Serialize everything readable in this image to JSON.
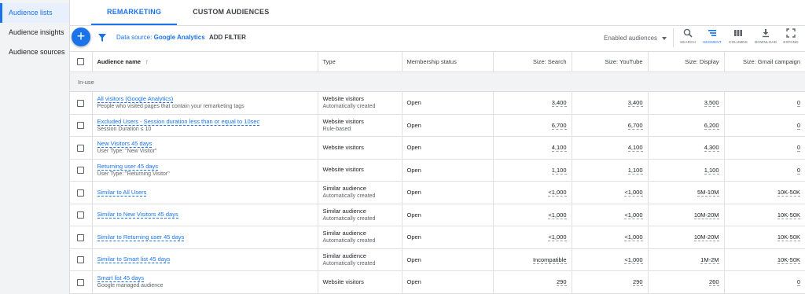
{
  "nav": {
    "items": [
      {
        "label": "Audience lists"
      },
      {
        "label": "Audience insights"
      },
      {
        "label": "Audience sources"
      }
    ]
  },
  "tabs": [
    {
      "label": "REMARKETING"
    },
    {
      "label": "CUSTOM AUDIENCES"
    }
  ],
  "toolbar": {
    "add": "+",
    "data_source_label": "Data source:",
    "data_source_value": "Google Analytics",
    "add_filter": "ADD FILTER",
    "status_filter": "Enabled audiences",
    "tools": {
      "search": "SEARCH",
      "segment": "SEGMENT",
      "columns": "COLUMNS",
      "download": "DOWNLOAD",
      "expand": "EXPAND"
    }
  },
  "table": {
    "headers": {
      "name": "Audience name",
      "sort": "↑",
      "type": "Type",
      "status": "Membership status",
      "search": "Size: Search",
      "youtube": "Size: YouTube",
      "display": "Size: Display",
      "gmail": "Size: Gmail campaign"
    },
    "group": "In-use",
    "rows": [
      {
        "name": "All visitors (Google Analytics)",
        "desc": "People who visited pages that contain your remarketing tags",
        "type": "Website visitors",
        "type_sub": "Automatically created",
        "status": "Open",
        "search": "3,400",
        "youtube": "3,400",
        "display": "3,500",
        "gmail": "0"
      },
      {
        "name": "Excluded Users - Session duration less than or equal to 10sec",
        "desc": "Session Duration ≤ 10",
        "type": "Website visitors",
        "type_sub": "Rule-based",
        "status": "Open",
        "search": "6,700",
        "youtube": "6,700",
        "display": "6,200",
        "gmail": "0"
      },
      {
        "name": "New Visitors 45 days",
        "desc": "User Type: \"New Visitor\"",
        "type": "Website visitors",
        "type_sub": "",
        "status": "Open",
        "search": "4,100",
        "youtube": "4,100",
        "display": "4,300",
        "gmail": "0"
      },
      {
        "name": "Returning user 45 days",
        "desc": "User Type: \"Returning Visitor\"",
        "type": "Website visitors",
        "type_sub": "",
        "status": "Open",
        "search": "1,100",
        "youtube": "1,100",
        "display": "1,100",
        "gmail": "0"
      },
      {
        "name": "Similar to All Users",
        "desc": "",
        "type": "Similar audience",
        "type_sub": "Automatically created",
        "status": "Open",
        "search": "<1,000",
        "youtube": "<1,000",
        "display": "5M-10M",
        "gmail": "10K-50K"
      },
      {
        "name": "Similar to New Visitors 45 days",
        "desc": "",
        "type": "Similar audience",
        "type_sub": "Automatically created",
        "status": "Open",
        "search": "<1,000",
        "youtube": "<1,000",
        "display": "10M-20M",
        "gmail": "10K-50K"
      },
      {
        "name": "Similar to Returning user 45 days",
        "desc": "",
        "type": "Similar audience",
        "type_sub": "Automatically created",
        "status": "Open",
        "search": "<1,000",
        "youtube": "<1,000",
        "display": "10M-20M",
        "gmail": "10K-50K"
      },
      {
        "name": "Similar to Smart list 45 days",
        "desc": "",
        "type": "Similar audience",
        "type_sub": "Automatically created",
        "status": "Open",
        "search": "Incompatible",
        "youtube": "<1,000",
        "display": "1M-2M",
        "gmail": "10K-50K"
      },
      {
        "name": "Smart list 45 days",
        "desc": "Google managed audience",
        "type": "Website visitors",
        "type_sub": "",
        "status": "Open",
        "search": "290",
        "youtube": "290",
        "display": "260",
        "gmail": "0"
      }
    ]
  },
  "colors": {
    "accent": "#1a73e8",
    "nav_bg": "#f1f3f4",
    "group_bg": "#f1f3f4"
  }
}
